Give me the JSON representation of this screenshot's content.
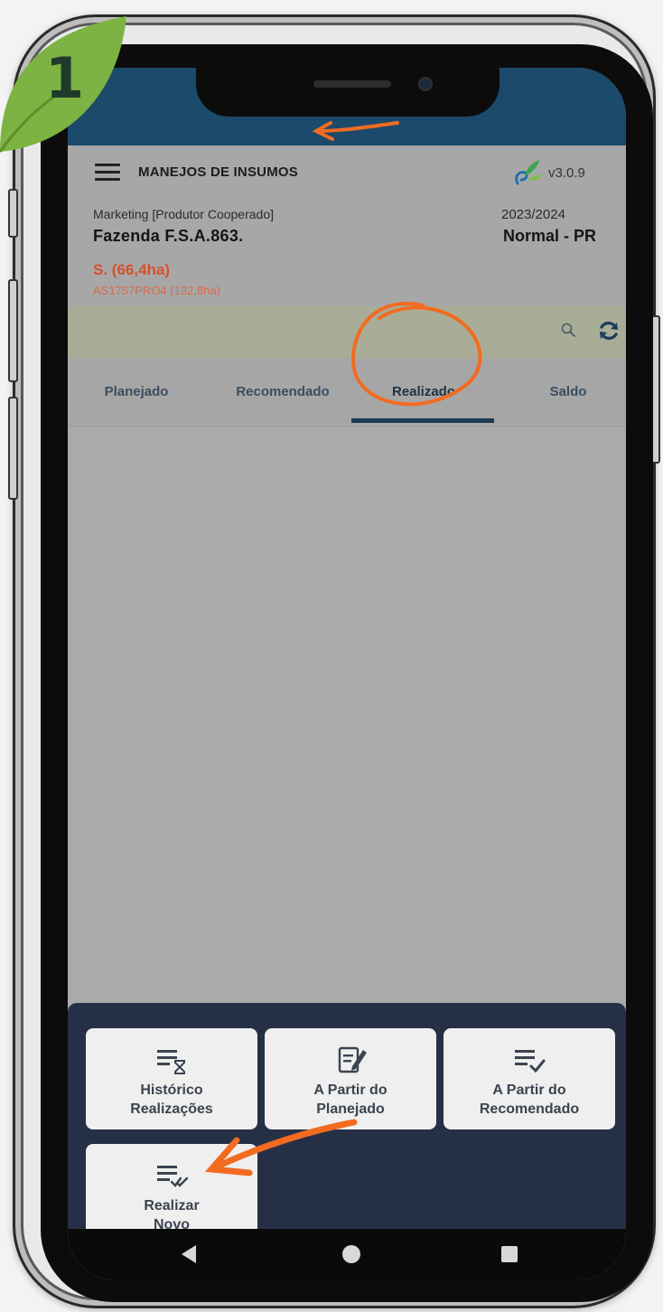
{
  "step_badge": {
    "number": "1",
    "color": "#7cb342"
  },
  "header": {
    "title": "MANEJOS DE INSUMOS",
    "version": "v3.0.9",
    "role": "Marketing [Produtor Cooperado]",
    "farm": "Fazenda F.S.A.863.",
    "season": "2023/2024",
    "region": "Normal - PR",
    "field": "S. (66,4ha)",
    "subfield": "AS1757PRO4 (132,8ha)"
  },
  "tabs": [
    {
      "label": "Planejado",
      "active": false
    },
    {
      "label": "Recomendado",
      "active": false
    },
    {
      "label": "Realizado",
      "active": true
    },
    {
      "label": "Saldo",
      "active": false
    }
  ],
  "actions": [
    {
      "label": "Histórico\nRealizações",
      "icon": "list-hourglass-icon"
    },
    {
      "label": "A Partir do\nPlanejado",
      "icon": "edit-document-icon"
    },
    {
      "label": "A Partir do\nRecomendado",
      "icon": "list-check-icon"
    },
    {
      "label": "Realizar\nNovo",
      "icon": "list-double-check-icon"
    }
  ],
  "colors": {
    "accent_orange": "#f26b21",
    "status_bar": "#1b4a6b",
    "bottom_sheet": "#253046",
    "field_text": "#d4512a"
  },
  "icons": {
    "menu": "hamburger-menu-icon",
    "search": "search-icon",
    "refresh": "refresh-icon",
    "logo": "app-leaf-logo-icon"
  }
}
